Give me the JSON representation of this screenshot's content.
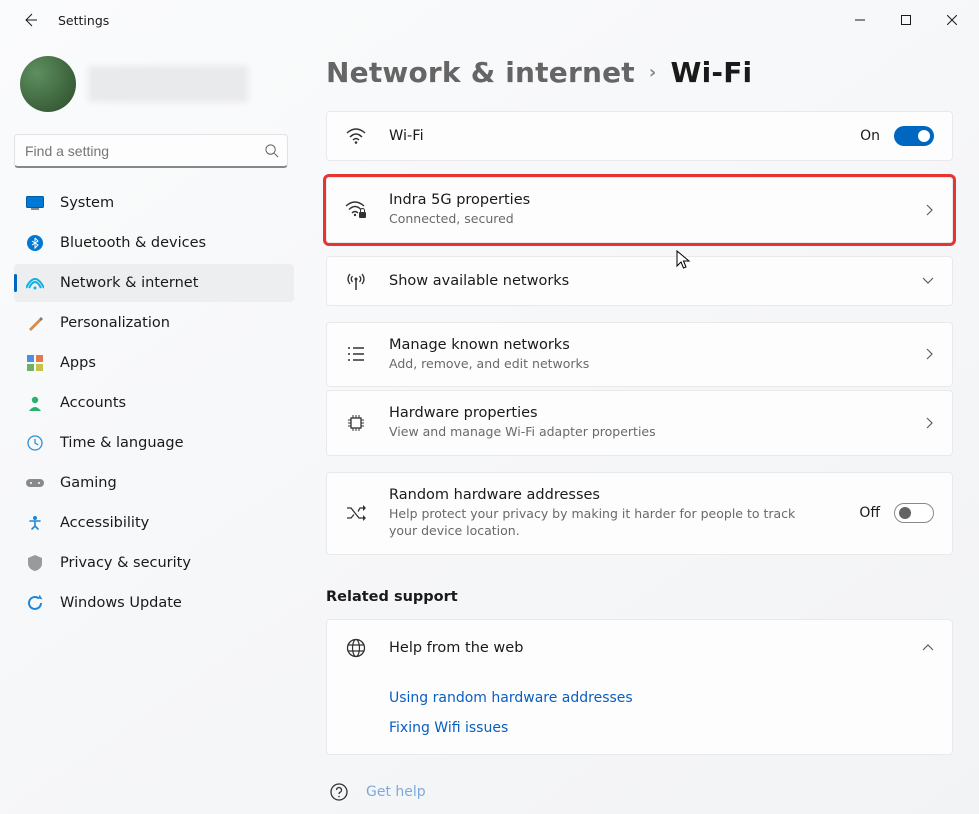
{
  "window": {
    "title": "Settings"
  },
  "search": {
    "placeholder": "Find a setting"
  },
  "sidebar": {
    "items": [
      {
        "label": "System"
      },
      {
        "label": "Bluetooth & devices"
      },
      {
        "label": "Network & internet"
      },
      {
        "label": "Personalization"
      },
      {
        "label": "Apps"
      },
      {
        "label": "Accounts"
      },
      {
        "label": "Time & language"
      },
      {
        "label": "Gaming"
      },
      {
        "label": "Accessibility"
      },
      {
        "label": "Privacy & security"
      },
      {
        "label": "Windows Update"
      }
    ]
  },
  "breadcrumb": {
    "root": "Network & internet",
    "current": "Wi-Fi"
  },
  "cards": {
    "wifi": {
      "title": "Wi-Fi",
      "state": "On"
    },
    "current": {
      "title": "Indra 5G properties",
      "sub": "Connected, secured"
    },
    "available": {
      "title": "Show available networks"
    },
    "known": {
      "title": "Manage known networks",
      "sub": "Add, remove, and edit networks"
    },
    "hardware": {
      "title": "Hardware properties",
      "sub": "View and manage Wi-Fi adapter properties"
    },
    "random": {
      "title": "Random hardware addresses",
      "sub": "Help protect your privacy by making it harder for people to track your device location.",
      "state": "Off"
    }
  },
  "related": {
    "heading": "Related support",
    "help_head": "Help from the web",
    "links": [
      "Using random hardware addresses",
      "Fixing Wifi issues"
    ]
  },
  "footer": {
    "get_help": "Get help"
  }
}
